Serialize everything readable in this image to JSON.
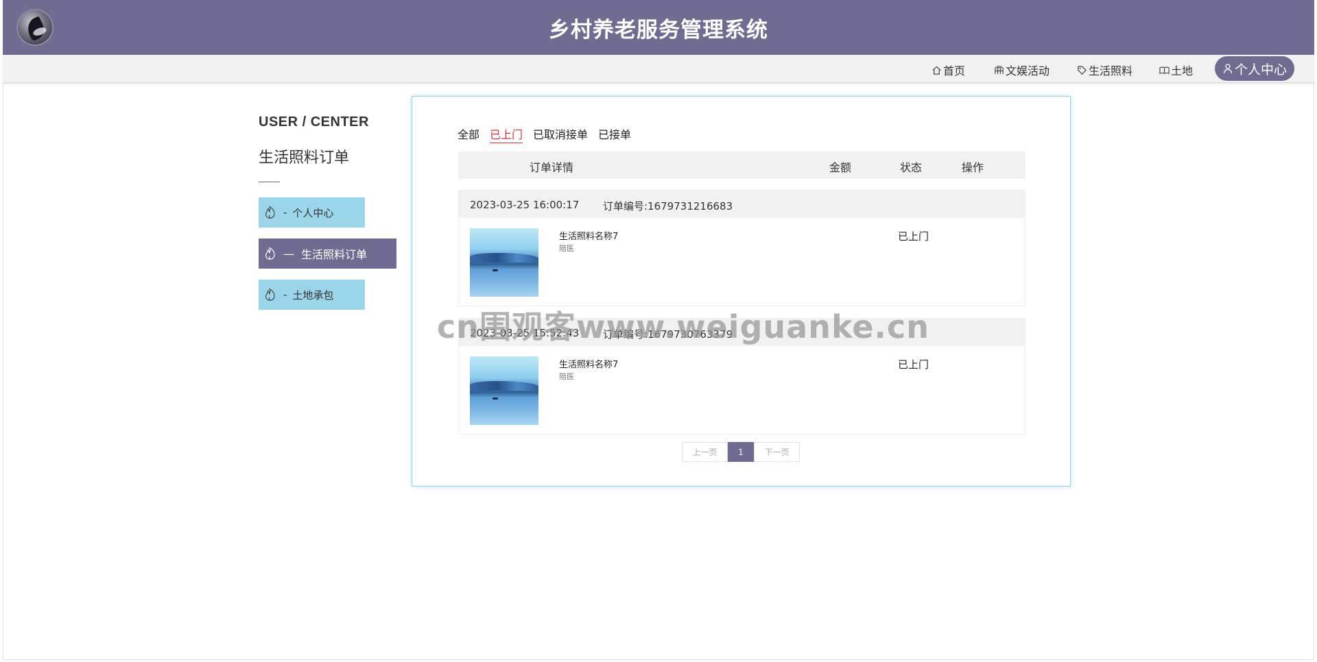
{
  "header": {
    "title": "乡村养老服务管理系统",
    "logo": "logo-emblem"
  },
  "nav": {
    "items": [
      {
        "label": "首页",
        "icon": "home-icon"
      },
      {
        "label": "文娱活动",
        "icon": "grid-icon"
      },
      {
        "label": "生活照料",
        "icon": "tag-icon"
      },
      {
        "label": "土地",
        "icon": "book-icon"
      },
      {
        "label": "个人中心",
        "icon": "user-icon",
        "active": true
      }
    ]
  },
  "sidebar": {
    "heading": "USER / CENTER",
    "title": "生活照料订单",
    "items": [
      {
        "prefix": "-",
        "label": "个人中心",
        "icon": "flame-icon"
      },
      {
        "prefix": "—",
        "label": "生活照料订单",
        "icon": "flame-icon",
        "active": true
      },
      {
        "prefix": "-",
        "label": "土地承包",
        "icon": "flame-icon"
      }
    ]
  },
  "tabs": [
    {
      "label": "全部"
    },
    {
      "label": "已上门",
      "active": true
    },
    {
      "label": "已取消接单"
    },
    {
      "label": "已接单"
    }
  ],
  "table": {
    "columns": [
      "订单详情",
      "金额",
      "状态",
      "操作"
    ]
  },
  "orders": [
    {
      "time": "2023-03-25 16:00:17",
      "number": "订单编号:1679731216683",
      "product": "生活照料名称7",
      "service": "陪医",
      "status": "已上门"
    },
    {
      "time": "2023-03-25 15:52:43",
      "number": "订单编号:1679730763379",
      "product": "生活照料名称7",
      "service": "陪医",
      "status": "已上门"
    }
  ],
  "pagination": {
    "prev": "上一页",
    "current": "1",
    "next": "下一页"
  },
  "watermark": "cn围观客www.weiguanke.cn",
  "colors": {
    "primary": "#6e6d91",
    "sidebar_light": "#9bd5ea",
    "tab_active": "#e62c2c",
    "panel_border": "#8fd0ef"
  }
}
